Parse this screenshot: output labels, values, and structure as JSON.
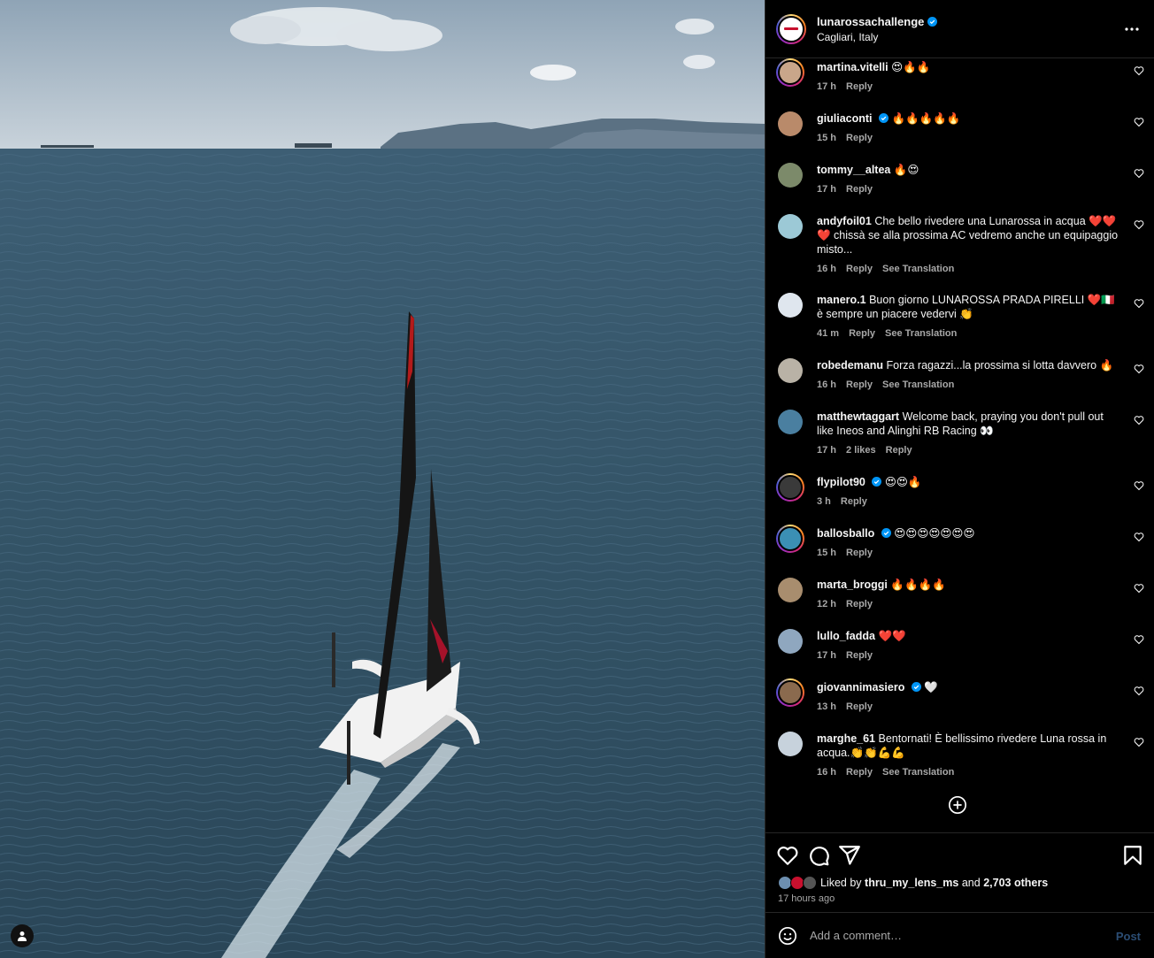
{
  "header": {
    "username": "lunarossachallenge",
    "location": "Cagliari, Italy"
  },
  "comments": [
    {
      "user": "martina.vitelli",
      "text": "😍🔥🔥",
      "time": "17 h",
      "reply": "Reply"
    },
    {
      "user": "giuliaconti",
      "text": "🔥🔥🔥🔥🔥",
      "time": "15 h",
      "reply": "Reply"
    },
    {
      "user": "tommy__altea",
      "text": "🔥😍",
      "time": "17 h",
      "reply": "Reply"
    },
    {
      "user": "andyfoil01",
      "text": "Che bello rivedere una Lunarossa in acqua ❤️❤️❤️ chissà se alla prossima AC vedremo anche un equipaggio misto...",
      "time": "16 h",
      "reply": "Reply",
      "translate": "See Translation"
    },
    {
      "user": "manero.1",
      "text": "Buon giorno LUNAROSSA PRADA PIRELLI ❤️🇮🇹 è sempre un piacere vedervi 👏",
      "time": "41 m",
      "reply": "Reply",
      "translate": "See Translation"
    },
    {
      "user": "robedemanu",
      "text": "Forza ragazzi...la prossima si lotta davvero 🔥",
      "time": "16 h",
      "reply": "Reply",
      "translate": "See Translation"
    },
    {
      "user": "matthewtaggart",
      "text": "Welcome back, praying you don't pull out like Ineos and Alinghi RB Racing 👀",
      "time": "17 h",
      "likes": "2 likes",
      "reply": "Reply"
    },
    {
      "user": "flypilot90",
      "text": "😍😍🔥",
      "time": "3 h",
      "reply": "Reply"
    },
    {
      "user": "ballosballo",
      "text": "😍😍😍😍😍😍😍",
      "time": "15 h",
      "reply": "Reply"
    },
    {
      "user": "marta_broggi",
      "text": "🔥🔥🔥🔥",
      "time": "12 h",
      "reply": "Reply"
    },
    {
      "user": "lullo_fadda",
      "text": "❤️❤️",
      "time": "17 h",
      "reply": "Reply"
    },
    {
      "user": "giovannimasiero",
      "text": "🤍",
      "time": "13 h",
      "reply": "Reply"
    },
    {
      "user": "marghe_61",
      "text": "Bentornati! È bellissimo rivedere Luna rossa in acqua.👏👏💪💪",
      "time": "16 h",
      "reply": "Reply",
      "translate": "See Translation"
    }
  ],
  "likes": {
    "prefix": "Liked by",
    "user": "thru_my_lens_ms",
    "and": "and",
    "others": "2,703 others"
  },
  "time_ago": "17 hours ago",
  "composer": {
    "placeholder": "Add a comment…",
    "post_label": "Post"
  },
  "colors": {
    "accent_blue": "#0095f6",
    "verified": "#0095f6",
    "post_disabled": "#2b4d74",
    "meta_gray": "#a8a8a8"
  }
}
